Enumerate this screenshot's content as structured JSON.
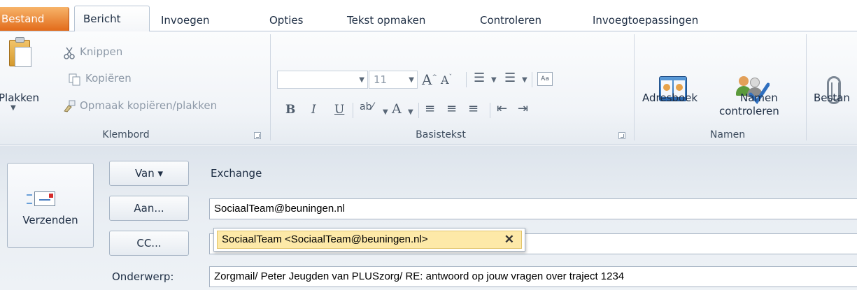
{
  "tabs": {
    "file": "Bestand",
    "items": [
      "Bericht",
      "Invoegen",
      "Opties",
      "Tekst opmaken",
      "Controleren",
      "Invoegtoepassingen"
    ]
  },
  "ribbon": {
    "clipboard": {
      "paste": "Plakken",
      "cut": "Knippen",
      "copy": "Kopiëren",
      "format_painter": "Opmaak kopiëren/plakken",
      "label": "Klembord"
    },
    "basic_text": {
      "font_size": "11",
      "label": "Basistekst",
      "bold": "B",
      "italic": "I",
      "underline": "U"
    },
    "names": {
      "address_book": "Adresboek",
      "check_names_1": "Namen",
      "check_names_2": "controleren",
      "label": "Namen"
    },
    "attach": "Bestan"
  },
  "form": {
    "send": "Verzenden",
    "from_button": "Van ▾",
    "from_value": "Exchange",
    "to_button": "Aan...",
    "to_value": "SociaalTeam@beuningen.nl",
    "cc_button": "CC...",
    "cc_value": "",
    "subject_label": "Onderwerp:",
    "subject_value": "Zorgmail/ Peter Jeugden van PLUSzorg/ RE: antwoord op jouw vragen over traject 1234",
    "suggestion": "SociaalTeam <SociaalTeam@beuningen.nl>"
  },
  "colors": {
    "file_tab": "#e26b1a",
    "ribbon_border": "#b7c4d4",
    "chip_bg": "#fde9a8"
  }
}
